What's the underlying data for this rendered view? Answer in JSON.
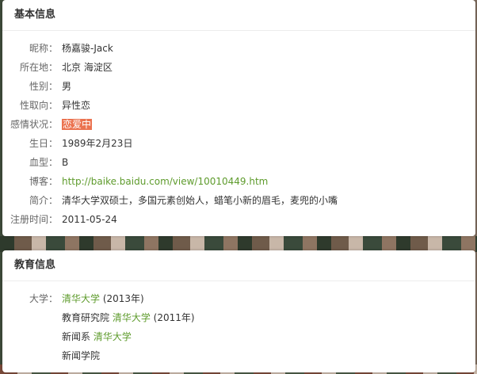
{
  "basic": {
    "title": "基本信息",
    "rows": [
      {
        "label": "昵称：",
        "value": "杨嘉骏-Jack"
      },
      {
        "label": "所在地：",
        "value": "北京 海淀区"
      },
      {
        "label": "性别：",
        "value": "男"
      },
      {
        "label": "性取向：",
        "value": "异性恋"
      },
      {
        "label": "感情状况：",
        "value": "恋爱中"
      },
      {
        "label": "生日：",
        "value": "1989年2月23日"
      },
      {
        "label": "血型：",
        "value": "B"
      },
      {
        "label": "博客：",
        "value": "http://baike.baidu.com/view/10010449.htm"
      },
      {
        "label": "简介：",
        "value": "清华大学双硕士，多国元素创始人，蜡笔小新的眉毛，麦兜的小嘴"
      },
      {
        "label": "注册时间：",
        "value": "2011-05-24"
      }
    ]
  },
  "education": {
    "title": "教育信息",
    "label": "大学：",
    "entries": [
      {
        "prefix": "",
        "school": "清华大学",
        "suffix": " (2013年)"
      },
      {
        "prefix": "教育研究院 ",
        "school": "清华大学",
        "suffix": " (2011年)"
      },
      {
        "prefix": "新闻系 ",
        "school": "清华大学",
        "suffix": ""
      },
      {
        "prefix": "新闻学院",
        "school": "",
        "suffix": ""
      }
    ]
  },
  "colors": {
    "link": "#5e9b2c",
    "status_highlight": "#eb7350"
  }
}
